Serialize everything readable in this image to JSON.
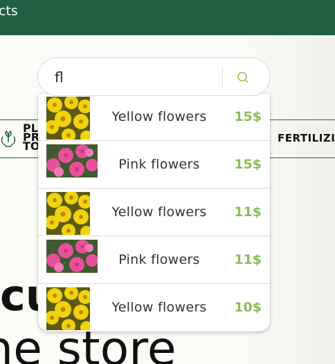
{
  "nav": {
    "title_fragment": "cts"
  },
  "categories": {
    "left_lines": [
      "PL",
      "PR",
      "TO"
    ],
    "right_label": "FERTILIZI"
  },
  "hero": {
    "title_fragment": "cu",
    "subtitle_fragment": "ne store"
  },
  "search": {
    "value": "fl",
    "icon": "search-icon"
  },
  "results": [
    {
      "name": "Yellow flowers",
      "price": "15$",
      "image": "yellow-flowers"
    },
    {
      "name": "Pink flowers",
      "price": "15$",
      "image": "pink-flowers"
    },
    {
      "name": "Yellow flowers",
      "price": "11$",
      "image": "yellow-flowers"
    },
    {
      "name": "Pink flowers",
      "price": "11$",
      "image": "pink-flowers"
    },
    {
      "name": "Yellow flowers",
      "price": "10$",
      "image": "yellow-flowers"
    }
  ],
  "colors": {
    "brand_green": "#1f6043",
    "price_green": "#8cbd55"
  }
}
